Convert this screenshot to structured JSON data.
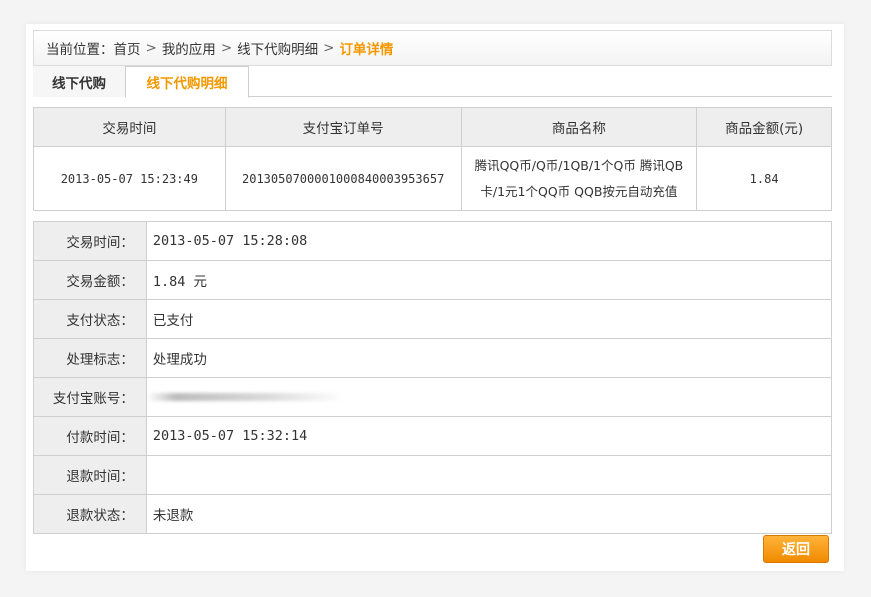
{
  "breadcrumb": {
    "prefix": "当前位置：",
    "separator": ">",
    "items": [
      "首页",
      "我的应用",
      "线下代购明细"
    ],
    "current": "订单详情"
  },
  "tabs": [
    {
      "label": "线下代购",
      "active": false
    },
    {
      "label": "线下代购明细",
      "active": true
    }
  ],
  "orders": {
    "columns": [
      "交易时间",
      "支付宝订单号",
      "商品名称",
      "商品金额(元)"
    ],
    "rows": [
      {
        "time": "2013-05-07 15:23:49",
        "alipay_order_no": "2013050700001000840003953657",
        "product_name_line1": "腾讯QQ币/Q币/1QB/1个Q币 腾讯QB",
        "product_name_line2": "卡/1元1个QQ币 QQB按元自动充值",
        "amount": "1.84"
      }
    ]
  },
  "details": [
    {
      "label": "交易时间：",
      "value": "2013-05-07 15:28:08",
      "mono": true
    },
    {
      "label": "交易金额：",
      "value": "1.84 元",
      "mono": true
    },
    {
      "label": "支付状态：",
      "value": "已支付"
    },
    {
      "label": "处理标志：",
      "value": "处理成功"
    },
    {
      "label": "支付宝账号：",
      "value": "",
      "redacted": true
    },
    {
      "label": "付款时间：",
      "value": "2013-05-07 15:32:14",
      "mono": true
    },
    {
      "label": "退款时间：",
      "value": ""
    },
    {
      "label": "退款状态：",
      "value": "未退款"
    }
  ],
  "back_button": "返回",
  "colors": {
    "accent": "#f39800",
    "button_top": "#ffb43a",
    "button_bottom": "#f08a00",
    "header_bg": "#eeeeee",
    "border": "#cfcfcf"
  }
}
